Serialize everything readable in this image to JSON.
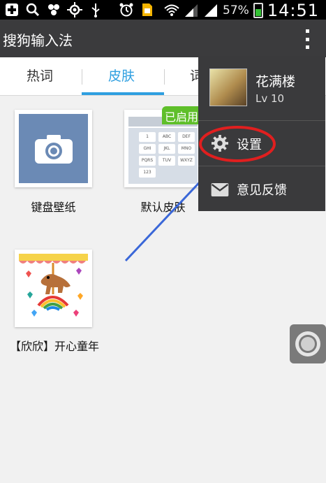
{
  "status_bar": {
    "battery_percent": "57%",
    "time": "14:51",
    "left_icons": [
      "plus-icon",
      "search-icon",
      "settings-icon",
      "gps-icon",
      "usb-icon",
      "alarm-icon",
      "sim-icon"
    ],
    "right_icons": [
      "wifi-icon",
      "signal-icon",
      "signal-icon",
      "battery-icon"
    ]
  },
  "app": {
    "title": "搜狗输入法"
  },
  "tabs": [
    {
      "label": "热词",
      "active": false
    },
    {
      "label": "皮肤",
      "active": true
    },
    {
      "label": "词",
      "active": false
    }
  ],
  "skins": [
    {
      "label": "键盘壁纸"
    },
    {
      "label": "默认皮肤",
      "badge": "已启用"
    },
    {
      "label": "【欣欣】开心童年"
    }
  ],
  "preview_keys": [
    "1",
    "ABC",
    "DEF",
    "GHI",
    "JKL",
    "MNO",
    "PQRS",
    "TUV",
    "WXYZ",
    "123"
  ],
  "menu": {
    "user_name": "花满楼",
    "user_level": "Lv 10",
    "items": [
      {
        "label": "设置",
        "icon": "gear-icon"
      },
      {
        "label": "意见反馈",
        "icon": "mail-icon"
      }
    ]
  },
  "colors": {
    "accent": "#2f9fe0",
    "appbar": "#3b3b3d",
    "annotation": "#e01f1f",
    "arrow": "#3a67d8"
  }
}
